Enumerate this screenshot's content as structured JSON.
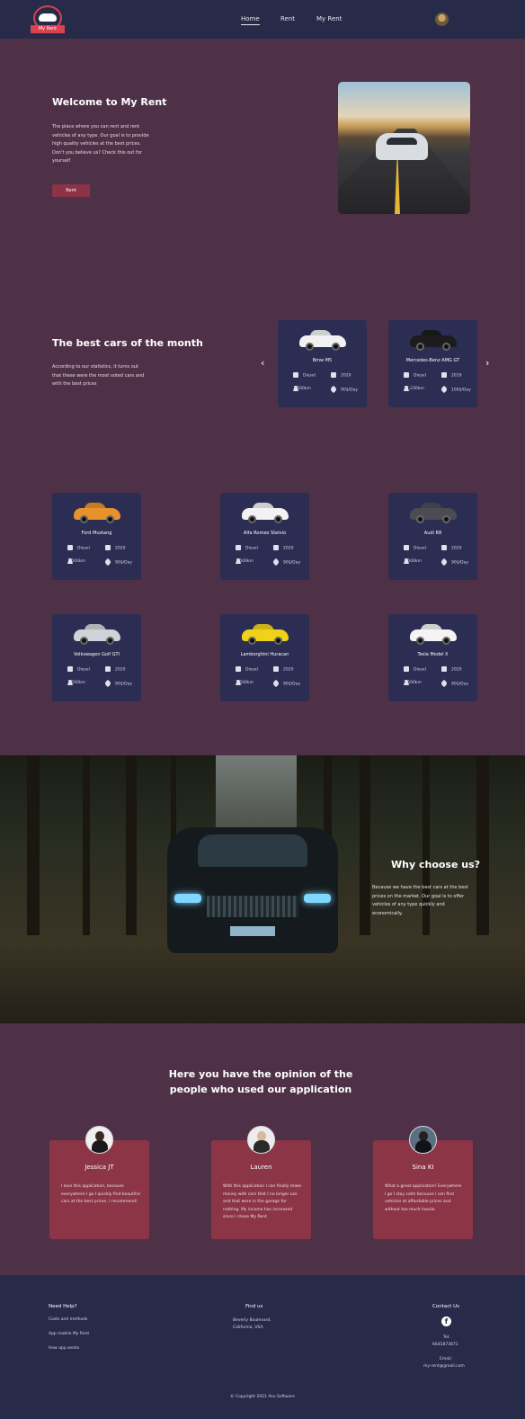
{
  "nav": {
    "logo_text": "My Rent",
    "links": [
      {
        "label": "Home",
        "active": true
      },
      {
        "label": "Rent",
        "active": false
      },
      {
        "label": "My Rent",
        "active": false
      }
    ]
  },
  "hero": {
    "title": "Welcome to My Rent",
    "text": "The place where you can rent and rent vehicles of any type. Our goal is to provide high quality vehicles at the best prices. Don't you believe us? Check this out for yourself",
    "button": "Rent"
  },
  "best": {
    "title": "The best cars of the month",
    "text": "According to our statistics, it turns out that these were the most voted cars and with the best prices",
    "prev": "‹",
    "next": "›",
    "cars": [
      {
        "name": "Bmw M5",
        "fuel": "Diesel",
        "year": "2020",
        "km": "7,500km",
        "price": "90$/Day",
        "color": "#f2f2f2"
      },
      {
        "name": "Mercedes-Benz AMG GT",
        "fuel": "Diesel",
        "year": "2019",
        "km": "37,230km",
        "price": "100$/Day",
        "color": "#1c1c1e"
      }
    ]
  },
  "fleet": [
    {
      "name": "Ford Mustang",
      "fuel": "Diesel",
      "year": "2020",
      "km": "7,500km",
      "price": "90$/Day",
      "color": "#e8922e"
    },
    {
      "name": "Alfa Romeo Stelvio",
      "fuel": "Diesel",
      "year": "2020",
      "km": "7,500km",
      "price": "90$/Day",
      "color": "#f2f2f2"
    },
    {
      "name": "Audi R8",
      "fuel": "Diesel",
      "year": "2020",
      "km": "7,500km",
      "price": "90$/Day",
      "color": "#4a4c52"
    },
    {
      "name": "Volkswagen Golf GTI",
      "fuel": "Diesel",
      "year": "2020",
      "km": "7,500km",
      "price": "90$/Day",
      "color": "#cfd2d6"
    },
    {
      "name": "Lamborghini Huracan",
      "fuel": "Diesel",
      "year": "2020",
      "km": "7,500km",
      "price": "90$/Day",
      "color": "#f1d21a"
    },
    {
      "name": "Tesla Model X",
      "fuel": "Diesel",
      "year": "2020",
      "km": "7,500km",
      "price": "90$/Day",
      "color": "#f4f4f4"
    }
  ],
  "why": {
    "title": "Why choose us?",
    "text": "Because we have the best cars at the best prices on the market. Our goal is to offer vehicles of any type quickly and economically."
  },
  "opinions": {
    "title_line1": "Here you have the opinion of the",
    "title_line2": "people who used our application",
    "items": [
      {
        "name": "Jessica JT",
        "text": "I love this application, because everywhere I go I quickly find beautiful cars at the best prices. I recommend!"
      },
      {
        "name": "Lauren",
        "text": "With this application I can finally make money with cars that I no longer use and that were in the garage for nothing. My income has increased since I chose My Rent"
      },
      {
        "name": "Sina KI",
        "text": "What a great application! Everywhere I go I stay calm because I can find vehicles at affordable prices and without too much hassle."
      }
    ]
  },
  "footer": {
    "help_title": "Need Help?",
    "help_items": [
      "Costs and methods",
      "App mobile My Rent",
      "How app works"
    ],
    "find_title": "Find us",
    "address_1": "Beverly Boulevard,",
    "address_2": "California, USA",
    "contact_title": "Contact Us",
    "facebook_icon": "f",
    "tel_label": "Tel:",
    "tel": "6645873871",
    "email_label": "Email:",
    "email": "my-rent@gmail.com",
    "copyright": "© Copyright 2021 Asu Software"
  }
}
